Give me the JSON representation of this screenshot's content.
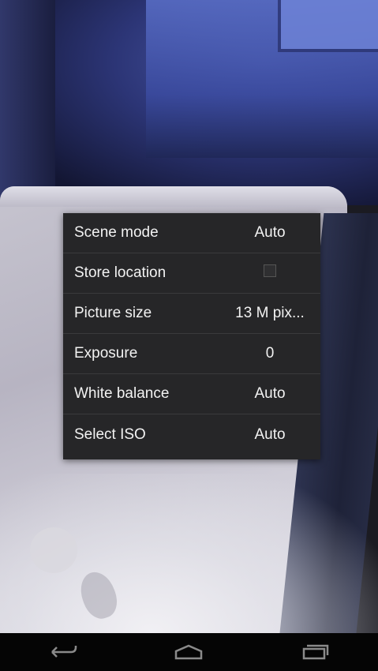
{
  "menu": {
    "items": [
      {
        "label": "Scene mode",
        "value": "Auto"
      },
      {
        "label": "Store location",
        "value": "",
        "checkbox": true,
        "checked": false
      },
      {
        "label": "Picture size",
        "value": "13 M pix..."
      },
      {
        "label": "Exposure",
        "value": "0"
      },
      {
        "label": "White balance",
        "value": "Auto"
      },
      {
        "label": "Select ISO",
        "value": "Auto"
      }
    ]
  },
  "navbar": {
    "icons": [
      "back-icon",
      "home-icon",
      "recent-apps-icon"
    ],
    "icon_color": "#8a8a8a"
  },
  "colors": {
    "menu_background": "#262628",
    "divider": "#3a3a3c",
    "text": "#f2f2f2"
  }
}
